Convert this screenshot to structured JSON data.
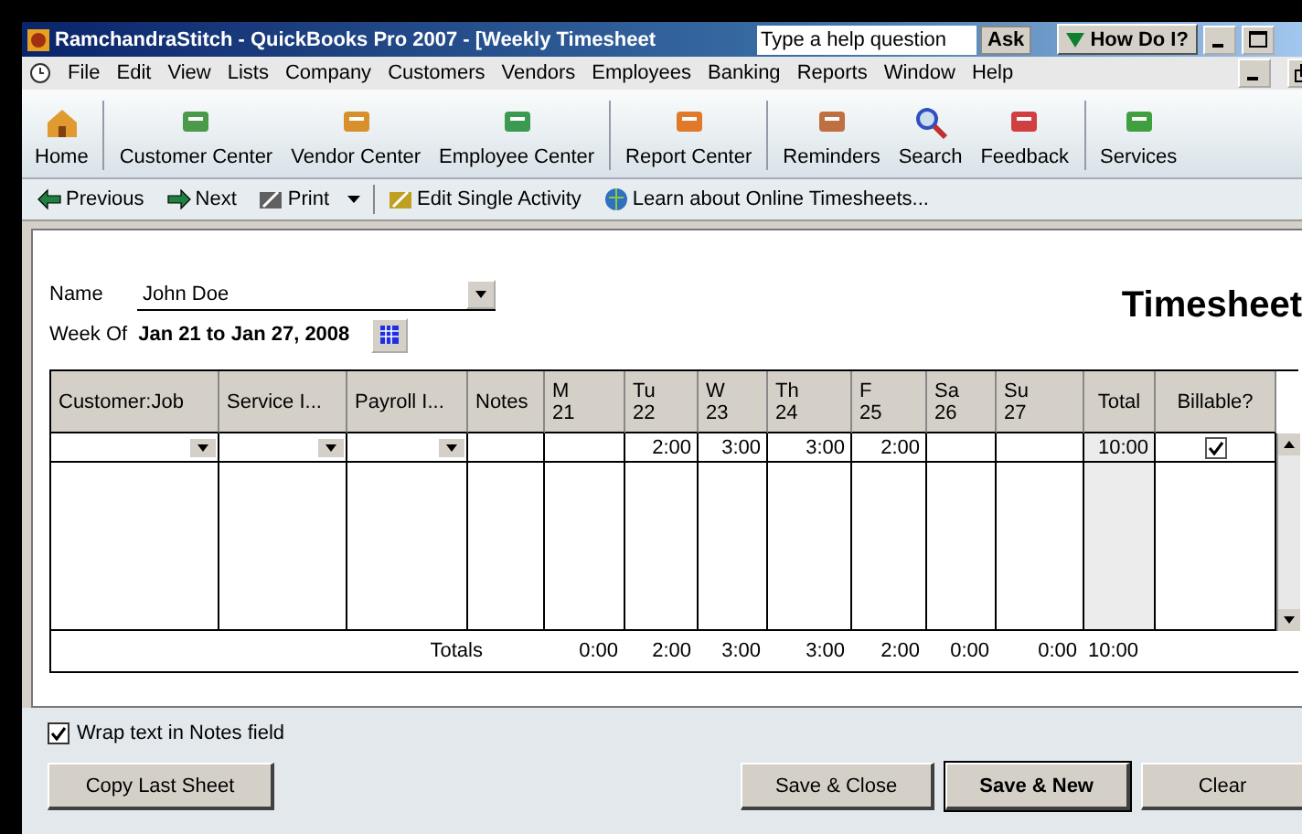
{
  "window": {
    "title": "RamchandraStitch - QuickBooks Pro 2007 - [Weekly Timesheet",
    "help_placeholder": "Type a help question",
    "ask": "Ask",
    "how_do_i": "How Do I?"
  },
  "menu": [
    "File",
    "Edit",
    "View",
    "Lists",
    "Company",
    "Customers",
    "Vendors",
    "Employees",
    "Banking",
    "Reports",
    "Window",
    "Help"
  ],
  "toolbar": [
    {
      "label": "Home",
      "kind": "home"
    },
    {
      "label": "Customer Center",
      "kind": "customer"
    },
    {
      "label": "Vendor Center",
      "kind": "vendor"
    },
    {
      "label": "Employee Center",
      "kind": "employee"
    },
    {
      "label": "Report Center",
      "kind": "report"
    },
    {
      "label": "Reminders",
      "kind": "reminders"
    },
    {
      "label": "Search",
      "kind": "search"
    },
    {
      "label": "Feedback",
      "kind": "feedback"
    },
    {
      "label": "Services",
      "kind": "services"
    }
  ],
  "actions": [
    {
      "label": "Previous",
      "kind": "previous"
    },
    {
      "label": "Next",
      "kind": "next"
    },
    {
      "label": "Print",
      "kind": "print"
    },
    {
      "label": "Edit Single Activity",
      "kind": "edit"
    },
    {
      "label": "Learn about Online Timesheets...",
      "kind": "learn"
    }
  ],
  "form": {
    "name_label": "Name",
    "name_value": "John Doe",
    "week_label": "Week Of",
    "week_value": "Jan 21 to Jan 27, 2008",
    "heading": "Timesheet"
  },
  "table": {
    "columns": [
      {
        "label": "Customer:Job"
      },
      {
        "label": "Service I..."
      },
      {
        "label": "Payroll I..."
      },
      {
        "label": "Notes"
      },
      {
        "label": "M",
        "date": "21"
      },
      {
        "label": "Tu",
        "date": "22"
      },
      {
        "label": "W",
        "date": "23"
      },
      {
        "label": "Th",
        "date": "24"
      },
      {
        "label": "F",
        "date": "25"
      },
      {
        "label": "Sa",
        "date": "26"
      },
      {
        "label": "Su",
        "date": "27"
      },
      {
        "label": "Total"
      },
      {
        "label": "Billable?"
      }
    ],
    "rows": [
      {
        "hours": {
          "tu": "2:00",
          "w": "3:00",
          "th": "3:00",
          "f": "2:00"
        },
        "total": "10:00",
        "billable": true
      }
    ],
    "totals_label": "Totals",
    "totals": [
      "0:00",
      "2:00",
      "3:00",
      "3:00",
      "2:00",
      "0:00",
      "0:00"
    ],
    "grand_total": "10:00"
  },
  "wrap_notes": {
    "label": "Wrap text in Notes field",
    "checked": true
  },
  "buttons": [
    {
      "label": "Copy Last Sheet",
      "kind": "left"
    },
    {
      "label": "Save & Close",
      "kind": "right"
    },
    {
      "label": "Save & New",
      "kind": "default"
    },
    {
      "label": "Clear",
      "kind": "right"
    }
  ]
}
